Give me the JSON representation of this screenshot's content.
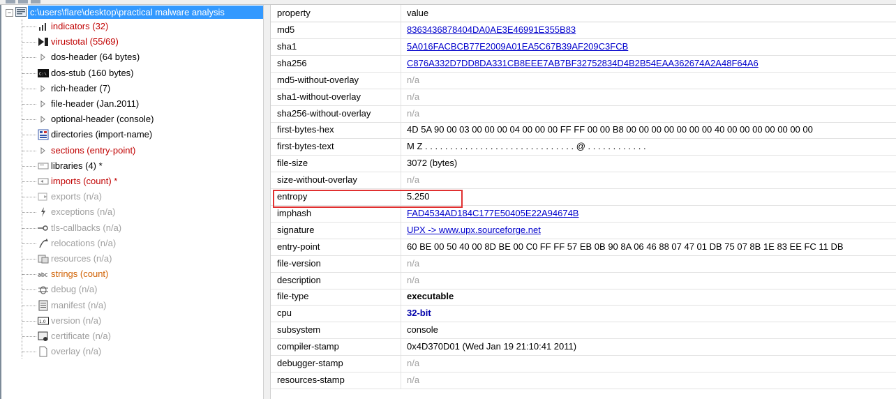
{
  "tree": {
    "root_label": "c:\\users\\flare\\desktop\\practical malware analysis",
    "items": [
      {
        "label": "indicators (32)",
        "color": "red",
        "icon": "bar-chart-icon"
      },
      {
        "label": "virustotal (55/69)",
        "color": "red",
        "icon": "virustotal-icon"
      },
      {
        "label": "dos-header (64 bytes)",
        "color": "blk",
        "icon": "triangle-right-icon"
      },
      {
        "label": "dos-stub (160 bytes)",
        "color": "blk",
        "icon": "console-icon"
      },
      {
        "label": "rich-header (7)",
        "color": "blk",
        "icon": "triangle-right-icon"
      },
      {
        "label": "file-header (Jan.2011)",
        "color": "blk",
        "icon": "triangle-right-icon"
      },
      {
        "label": "optional-header (console)",
        "color": "blk",
        "icon": "triangle-right-icon"
      },
      {
        "label": "directories (import-name)",
        "color": "blk",
        "icon": "directories-icon"
      },
      {
        "label": "sections (entry-point)",
        "color": "red",
        "icon": "triangle-right-icon"
      },
      {
        "label": "libraries (4) *",
        "color": "blk",
        "icon": "library-icon"
      },
      {
        "label": "imports (count) *",
        "color": "red",
        "icon": "imports-icon"
      },
      {
        "label": "exports (n/a)",
        "color": "gray",
        "icon": "exports-icon"
      },
      {
        "label": "exceptions (n/a)",
        "color": "gray",
        "icon": "exceptions-icon"
      },
      {
        "label": "tls-callbacks (n/a)",
        "color": "gray",
        "icon": "tls-callbacks-icon"
      },
      {
        "label": "relocations (n/a)",
        "color": "gray",
        "icon": "relocations-icon"
      },
      {
        "label": "resources (n/a)",
        "color": "gray",
        "icon": "resources-icon"
      },
      {
        "label": "strings (count)",
        "color": "orange",
        "icon": "abc-icon"
      },
      {
        "label": "debug (n/a)",
        "color": "gray",
        "icon": "debug-bug-icon"
      },
      {
        "label": "manifest (n/a)",
        "color": "gray",
        "icon": "manifest-icon"
      },
      {
        "label": "version (n/a)",
        "color": "gray",
        "icon": "version-icon"
      },
      {
        "label": "certificate (n/a)",
        "color": "gray",
        "icon": "certificate-icon"
      },
      {
        "label": "overlay (n/a)",
        "color": "gray",
        "icon": "document-icon"
      }
    ]
  },
  "table": {
    "header": {
      "property": "property",
      "value": "value"
    },
    "rows": [
      {
        "property": "md5",
        "value": "8363436878404DA0AE3E46991E355B83",
        "style": "link"
      },
      {
        "property": "sha1",
        "value": "5A016FACBCB77E2009A01EA5C67B39AF209C3FCB",
        "style": "link"
      },
      {
        "property": "sha256",
        "value": "C876A332D7DD8DA331CB8EEE7AB7BF32752834D4B2B54EAA362674A2A48F64A6",
        "style": "link"
      },
      {
        "property": "md5-without-overlay",
        "value": "n/a",
        "style": "na"
      },
      {
        "property": "sha1-without-overlay",
        "value": "n/a",
        "style": "na"
      },
      {
        "property": "sha256-without-overlay",
        "value": "n/a",
        "style": "na"
      },
      {
        "property": "first-bytes-hex",
        "value": "4D 5A 90 00 03 00 00 00 04 00 00 00 FF FF 00 00 B8 00 00 00 00 00 00 00 40 00 00 00 00 00 00 00",
        "style": "plain"
      },
      {
        "property": "first-bytes-text",
        "value": "M Z . . . . . . . . . . . . . . . . . . . . . . . . . . . . . . @ . . . . . . . . . . . .",
        "style": "plain"
      },
      {
        "property": "file-size",
        "value": "3072 (bytes)",
        "style": "plain"
      },
      {
        "property": "size-without-overlay",
        "value": "n/a",
        "style": "na"
      },
      {
        "property": "entropy",
        "value": "5.250",
        "style": "plain"
      },
      {
        "property": "imphash",
        "value": "FAD4534AD184C177E50405E22A94674B",
        "style": "link"
      },
      {
        "property": "signature",
        "value": "UPX -> www.upx.sourceforge.net",
        "style": "link"
      },
      {
        "property": "entry-point",
        "value": "60 BE 00 50 40 00 8D BE 00 C0 FF FF 57 EB 0B 90 8A 06 46 88 07 47 01 DB 75 07 8B 1E 83 EE FC 11 DB",
        "style": "plain"
      },
      {
        "property": "file-version",
        "value": "n/a",
        "style": "na"
      },
      {
        "property": "description",
        "value": "n/a",
        "style": "na"
      },
      {
        "property": "file-type",
        "value": "executable",
        "style": "bold"
      },
      {
        "property": "cpu",
        "value": "32-bit",
        "style": "boldblue"
      },
      {
        "property": "subsystem",
        "value": "console",
        "style": "plain"
      },
      {
        "property": "compiler-stamp",
        "value": "0x4D370D01 (Wed Jan 19 21:10:41 2011)",
        "style": "plain"
      },
      {
        "property": "debugger-stamp",
        "value": "n/a",
        "style": "na"
      },
      {
        "property": "resources-stamp",
        "value": "n/a",
        "style": "na"
      }
    ],
    "highlighted_property": "entropy"
  },
  "colors": {
    "selection": "#3399ff",
    "highlight_box": "#e03030",
    "link": "#0000cc",
    "red_item": "#c00000"
  }
}
